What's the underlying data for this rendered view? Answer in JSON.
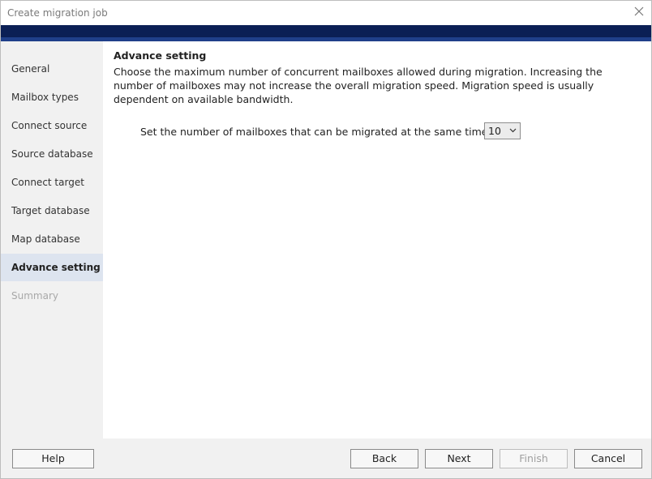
{
  "window": {
    "title": "Create migration job"
  },
  "sidebar": {
    "items": [
      {
        "label": "General"
      },
      {
        "label": "Mailbox types"
      },
      {
        "label": "Connect source"
      },
      {
        "label": "Source database"
      },
      {
        "label": "Connect target"
      },
      {
        "label": "Target database"
      },
      {
        "label": "Map database"
      },
      {
        "label": "Advance setting"
      },
      {
        "label": "Summary"
      }
    ],
    "active": "Advance setting",
    "disabled": [
      "Summary"
    ]
  },
  "main": {
    "heading": "Advance setting",
    "description": "Choose the maximum number of concurrent mailboxes allowed during migration. Increasing the number of mailboxes may not increase the overall migration speed. Migration speed is usually dependent on available bandwidth.",
    "setting_label": "Set the number of mailboxes that can be migrated at the same time to:",
    "concurrency_value": "10"
  },
  "footer": {
    "help_label": "Help",
    "back_label": "Back",
    "next_label": "Next",
    "finish_label": "Finish",
    "cancel_label": "Cancel"
  },
  "colors": {
    "banner": "#0b1f55",
    "sidebar_active": "#dde4ef"
  },
  "icons": {
    "close": "close-icon",
    "dropdown": "chevron-down-icon"
  }
}
